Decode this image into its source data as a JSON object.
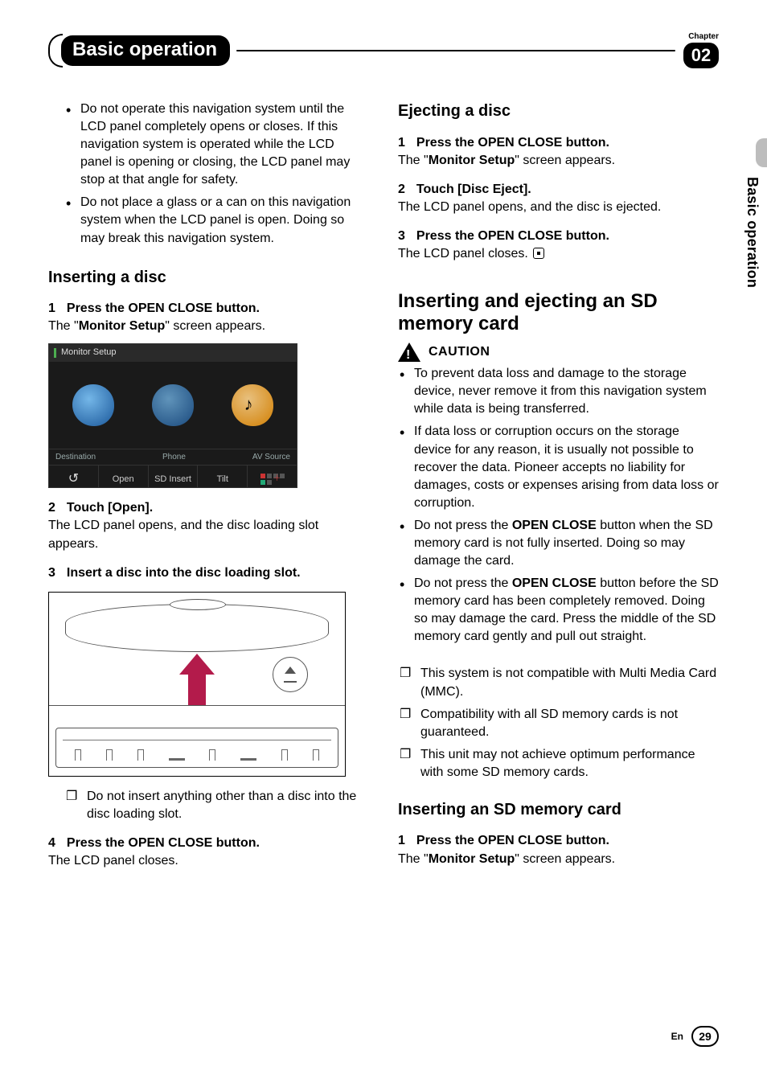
{
  "header": {
    "title": "Basic operation",
    "chapter_label": "Chapter",
    "chapter_number": "02"
  },
  "side_tab": "Basic operation",
  "left_column": {
    "intro_bullets": [
      "Do not operate this navigation system until the LCD panel completely opens or closes. If this navigation system is operated while the LCD panel is opening or closing, the LCD panel may stop at that angle for safety.",
      "Do not place a glass or a can on this navigation system when the LCD panel is open. Doing so may break this navigation system."
    ],
    "inserting_disc": {
      "heading": "Inserting a disc",
      "step1_head": "Press the OPEN CLOSE button.",
      "step1_body_pre": "The \"",
      "step1_body_bold": "Monitor Setup",
      "step1_body_post": "\" screen appears.",
      "screenshot": {
        "title": "Monitor Setup",
        "row_left": "Destination",
        "row_mid": "Phone",
        "row_right": "AV Source",
        "btn_open": "Open",
        "btn_sd": "SD Insert",
        "btn_tilt": "Tilt"
      },
      "step2_head": "Touch [Open].",
      "step2_body": "The LCD panel opens, and the disc loading slot appears.",
      "step3_head": "Insert a disc into the disc loading slot.",
      "note_bullets": [
        "Do not insert anything other than a disc into the disc loading slot."
      ],
      "step4_head": "Press the OPEN CLOSE button.",
      "step4_body": "The LCD panel closes."
    }
  },
  "right_column": {
    "ejecting_disc": {
      "heading": "Ejecting a disc",
      "step1_head": "Press the OPEN CLOSE button.",
      "step1_body_pre": "The \"",
      "step1_body_bold": "Monitor Setup",
      "step1_body_post": "\" screen appears.",
      "step2_head": "Touch [Disc Eject].",
      "step2_body": "The LCD panel opens, and the disc is ejected.",
      "step3_head": "Press the OPEN CLOSE button.",
      "step3_body": "The LCD panel closes."
    },
    "sd_section": {
      "heading": "Inserting and ejecting an SD memory card",
      "caution_label": "CAUTION",
      "caution_bullets": [
        "To prevent data loss and damage to the storage device, never remove it from this navigation system while data is being transferred.",
        "If data loss or corruption occurs on the storage device for any reason, it is usually not possible to recover the data. Pioneer accepts no liability for damages, costs or expenses arising from data loss or corruption.",
        "Do not press the OPEN CLOSE button when the SD memory card is not fully inserted. Doing so may damage the card.",
        "Do not press the OPEN CLOSE button before the SD memory card has been completely removed. Doing so may damage the card. Press the middle of the SD memory card gently and pull out straight."
      ],
      "open_close_bold": "OPEN CLOSE",
      "note_bullets": [
        "This system is not compatible with Multi Media Card (MMC).",
        "Compatibility with all SD memory cards is not guaranteed.",
        "This unit may not achieve optimum performance with some SD memory cards."
      ],
      "insert_sd_heading": "Inserting an SD memory card",
      "step1_head": "Press the OPEN CLOSE button.",
      "step1_body_pre": "The \"",
      "step1_body_bold": "Monitor Setup",
      "step1_body_post": "\" screen appears."
    }
  },
  "footer": {
    "lang": "En",
    "page": "29"
  }
}
